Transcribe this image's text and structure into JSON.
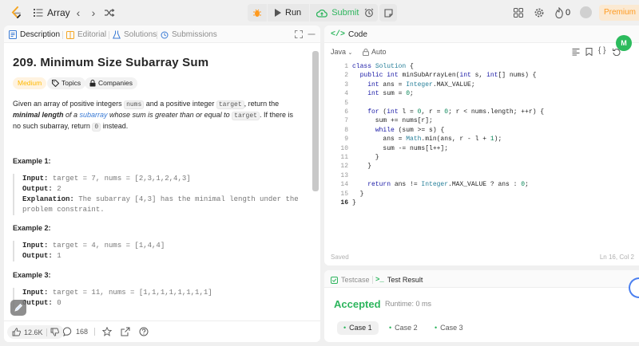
{
  "topbar": {
    "list_title": "Array",
    "run_label": "Run",
    "submit_label": "Submit",
    "streak_count": "0",
    "premium_label": "Premium"
  },
  "left": {
    "tabs": [
      "Description",
      "Editorial",
      "Solutions",
      "Submissions"
    ],
    "title": "209. Minimum Size Subarray Sum",
    "difficulty": "Medium",
    "chips": [
      "Topics",
      "Companies"
    ],
    "description": {
      "p1": "Given an array of positive integers ",
      "c1": "nums",
      "p2": " and a positive integer ",
      "c2": "target",
      "p3": ", return the ",
      "b1": "minimal length",
      "p4": " of a ",
      "link": "subarray",
      "p5": " whose sum is greater than or equal to ",
      "c3": "target",
      "p6": ". If there is no such subarray, return ",
      "c4": "0",
      "p7": " instead."
    },
    "examples": [
      {
        "title": "Example 1:",
        "input_label": "Input:",
        "input": "target = 7, nums = [2,3,1,2,4,3]",
        "output_label": "Output:",
        "output": "2",
        "explanation_label": "Explanation:",
        "explanation_1": "The subarray [4,3] has the minimal length under the",
        "explanation_2": "problem constraint."
      },
      {
        "title": "Example 2:",
        "input_label": "Input:",
        "input": "target = 4, nums = [1,4,4]",
        "output_label": "Output:",
        "output": "1"
      },
      {
        "title": "Example 3:",
        "input_label": "Input:",
        "input": "target = 11, nums = [1,1,1,1,1,1,1,1]",
        "output_label": "Output:",
        "output": "0"
      }
    ],
    "footer": {
      "likes": "12.6K",
      "comments": "168"
    }
  },
  "code": {
    "tab_label": "Code",
    "language": "Java",
    "mode": "Auto",
    "line_numbers": [
      "1",
      "2",
      "3",
      "4",
      "5",
      "6",
      "7",
      "8",
      "9",
      "10",
      "11",
      "12",
      "13",
      "14",
      "15",
      "16"
    ],
    "saved_label": "Saved",
    "cursor_position": "Ln 16, Col 2",
    "avatar_initials": "M"
  },
  "result": {
    "tabs": [
      "Testcase",
      "Test Result"
    ],
    "status": "Accepted",
    "runtime": "Runtime: 0 ms",
    "cases": [
      "Case 1",
      "Case 2",
      "Case 3"
    ]
  },
  "colors": {
    "accent_green": "#2db55d",
    "medium_orange": "#ffb800",
    "premium_orange": "#ff9a1f",
    "link_blue": "#3a7bd5"
  }
}
